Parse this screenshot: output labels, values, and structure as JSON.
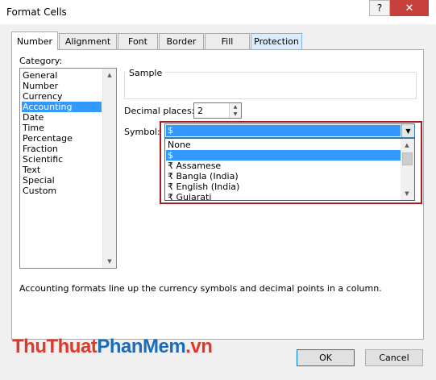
{
  "window": {
    "title": "Format Cells",
    "help_label": "?",
    "close_label": "✕"
  },
  "tabs": [
    {
      "label": "Number"
    },
    {
      "label": "Alignment"
    },
    {
      "label": "Font"
    },
    {
      "label": "Border"
    },
    {
      "label": "Fill"
    },
    {
      "label": "Protection"
    }
  ],
  "category": {
    "label": "Category:",
    "items": [
      "General",
      "Number",
      "Currency",
      "Accounting",
      "Date",
      "Time",
      "Percentage",
      "Fraction",
      "Scientific",
      "Text",
      "Special",
      "Custom"
    ],
    "selected": "Accounting"
  },
  "sample": {
    "legend": "Sample"
  },
  "decimal": {
    "label": "Decimal places:",
    "value": "2"
  },
  "symbol": {
    "label": "Symbol:",
    "selected": "$",
    "options": [
      "None",
      "$",
      "₹ Assamese",
      "₹ Bangla (India)",
      "₹ English (India)",
      "₹ Gujarati"
    ]
  },
  "description": "Accounting formats line up the currency symbols and decimal points in a column.",
  "watermark": {
    "part1": "ThuThuat",
    "part2": "PhanMem",
    "part3": ".vn"
  },
  "buttons": {
    "ok": "OK",
    "cancel": "Cancel"
  },
  "colors": {
    "accent": "#3399ff",
    "close": "#c7413c",
    "highlight_frame": "#a61c23"
  }
}
